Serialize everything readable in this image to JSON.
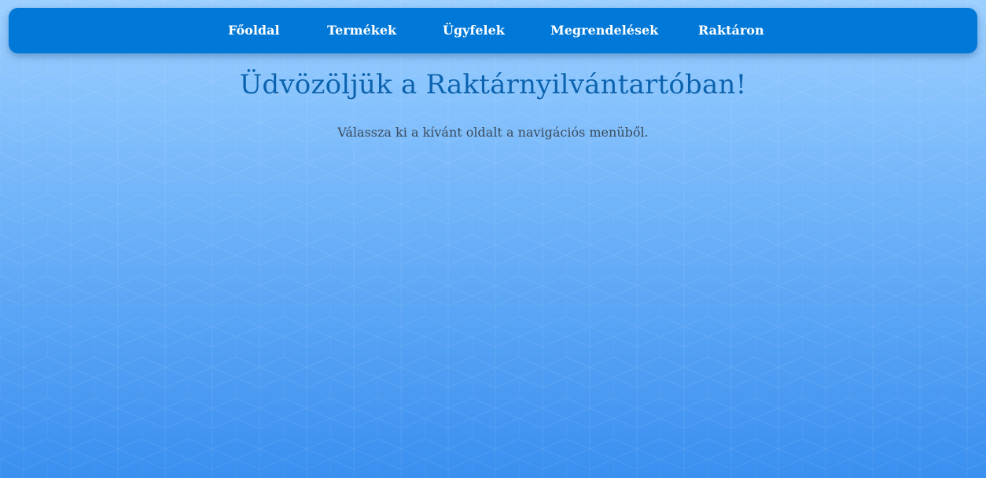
{
  "nav": {
    "items": [
      {
        "label": "Főoldal"
      },
      {
        "label": "Termékek"
      },
      {
        "label": "Ügyfelek"
      },
      {
        "label": "Megrendelések"
      },
      {
        "label": "Raktáron"
      }
    ]
  },
  "main": {
    "title": "Üdvözöljük a Raktárnyilvántartóban!",
    "subtitle": "Válassza ki a kívánt oldalt a navigációs menüből."
  },
  "colors": {
    "nav_background": "#0078d7",
    "title_color": "#0b63b0",
    "page_gradient_top": "#9dd0ff",
    "page_gradient_bottom": "#3a8ff0"
  }
}
